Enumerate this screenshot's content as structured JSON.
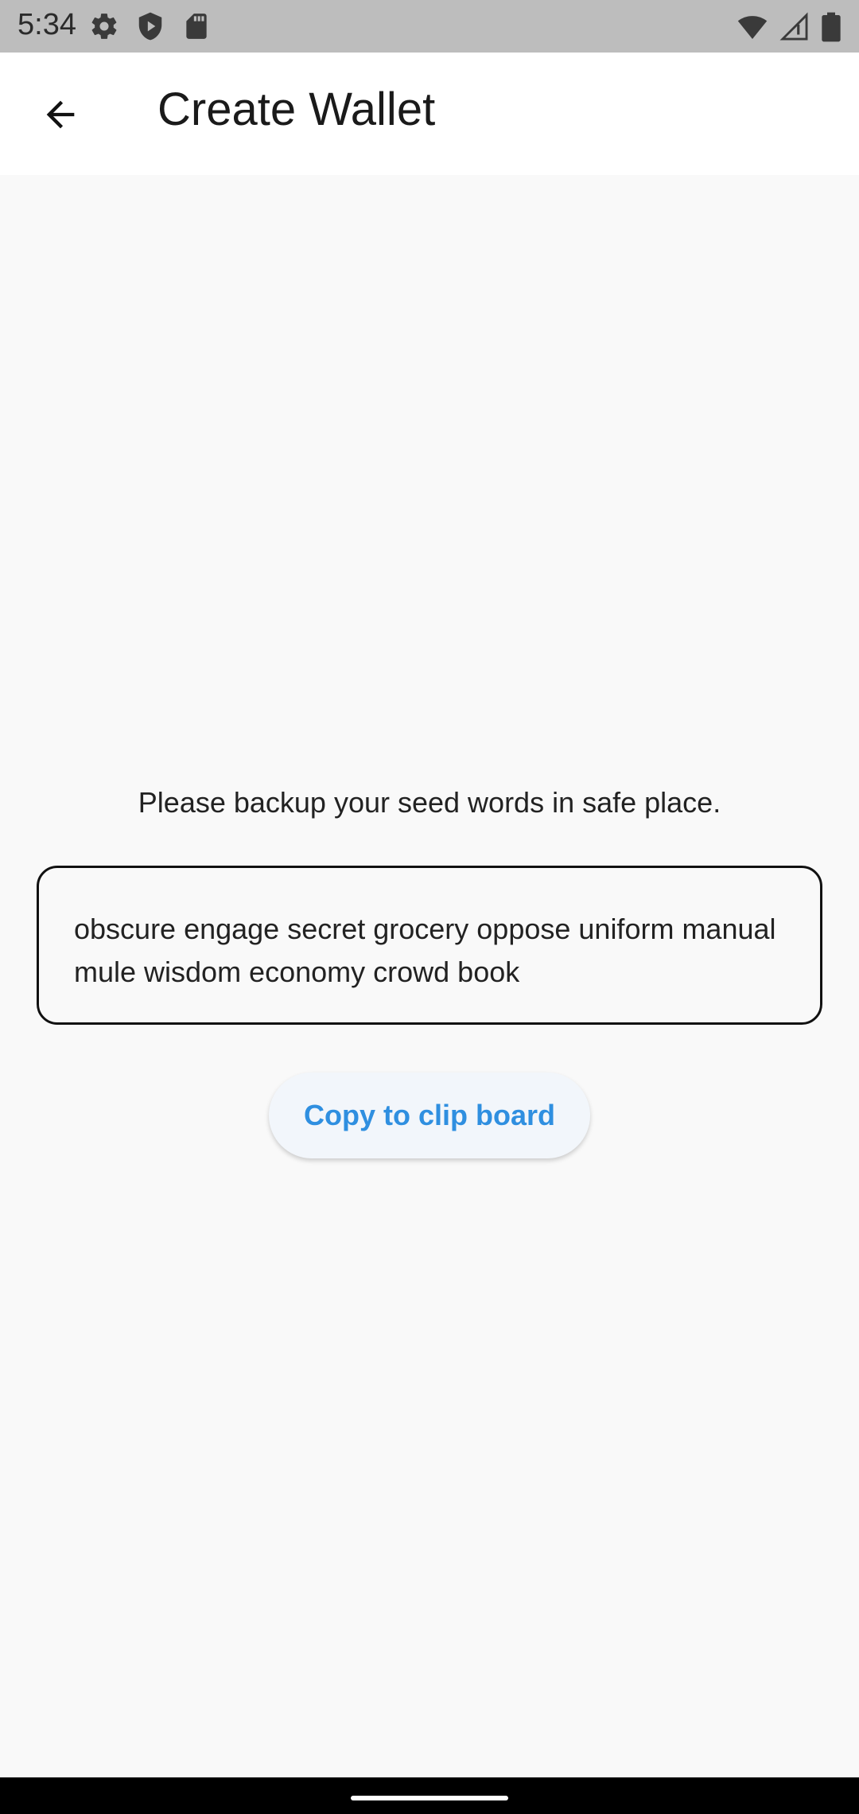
{
  "status_bar": {
    "time": "5:34",
    "left_icons": [
      "settings-gear-icon",
      "shield-icon",
      "sd-card-icon"
    ],
    "right_icons": [
      "wifi-icon",
      "signal-icon",
      "battery-icon"
    ]
  },
  "app_bar": {
    "title": "Create Wallet",
    "back_icon": "arrow-back-icon"
  },
  "main": {
    "instruction": "Please backup your seed words in safe place.",
    "seed_words": "obscure engage secret grocery oppose uniform manual mule wisdom economy crowd book",
    "copy_button_label": "Copy to clip board"
  },
  "colors": {
    "accent": "#2f8fe0",
    "status_bar_bg": "#bdbdbd",
    "page_bg": "#f9f9f9"
  }
}
